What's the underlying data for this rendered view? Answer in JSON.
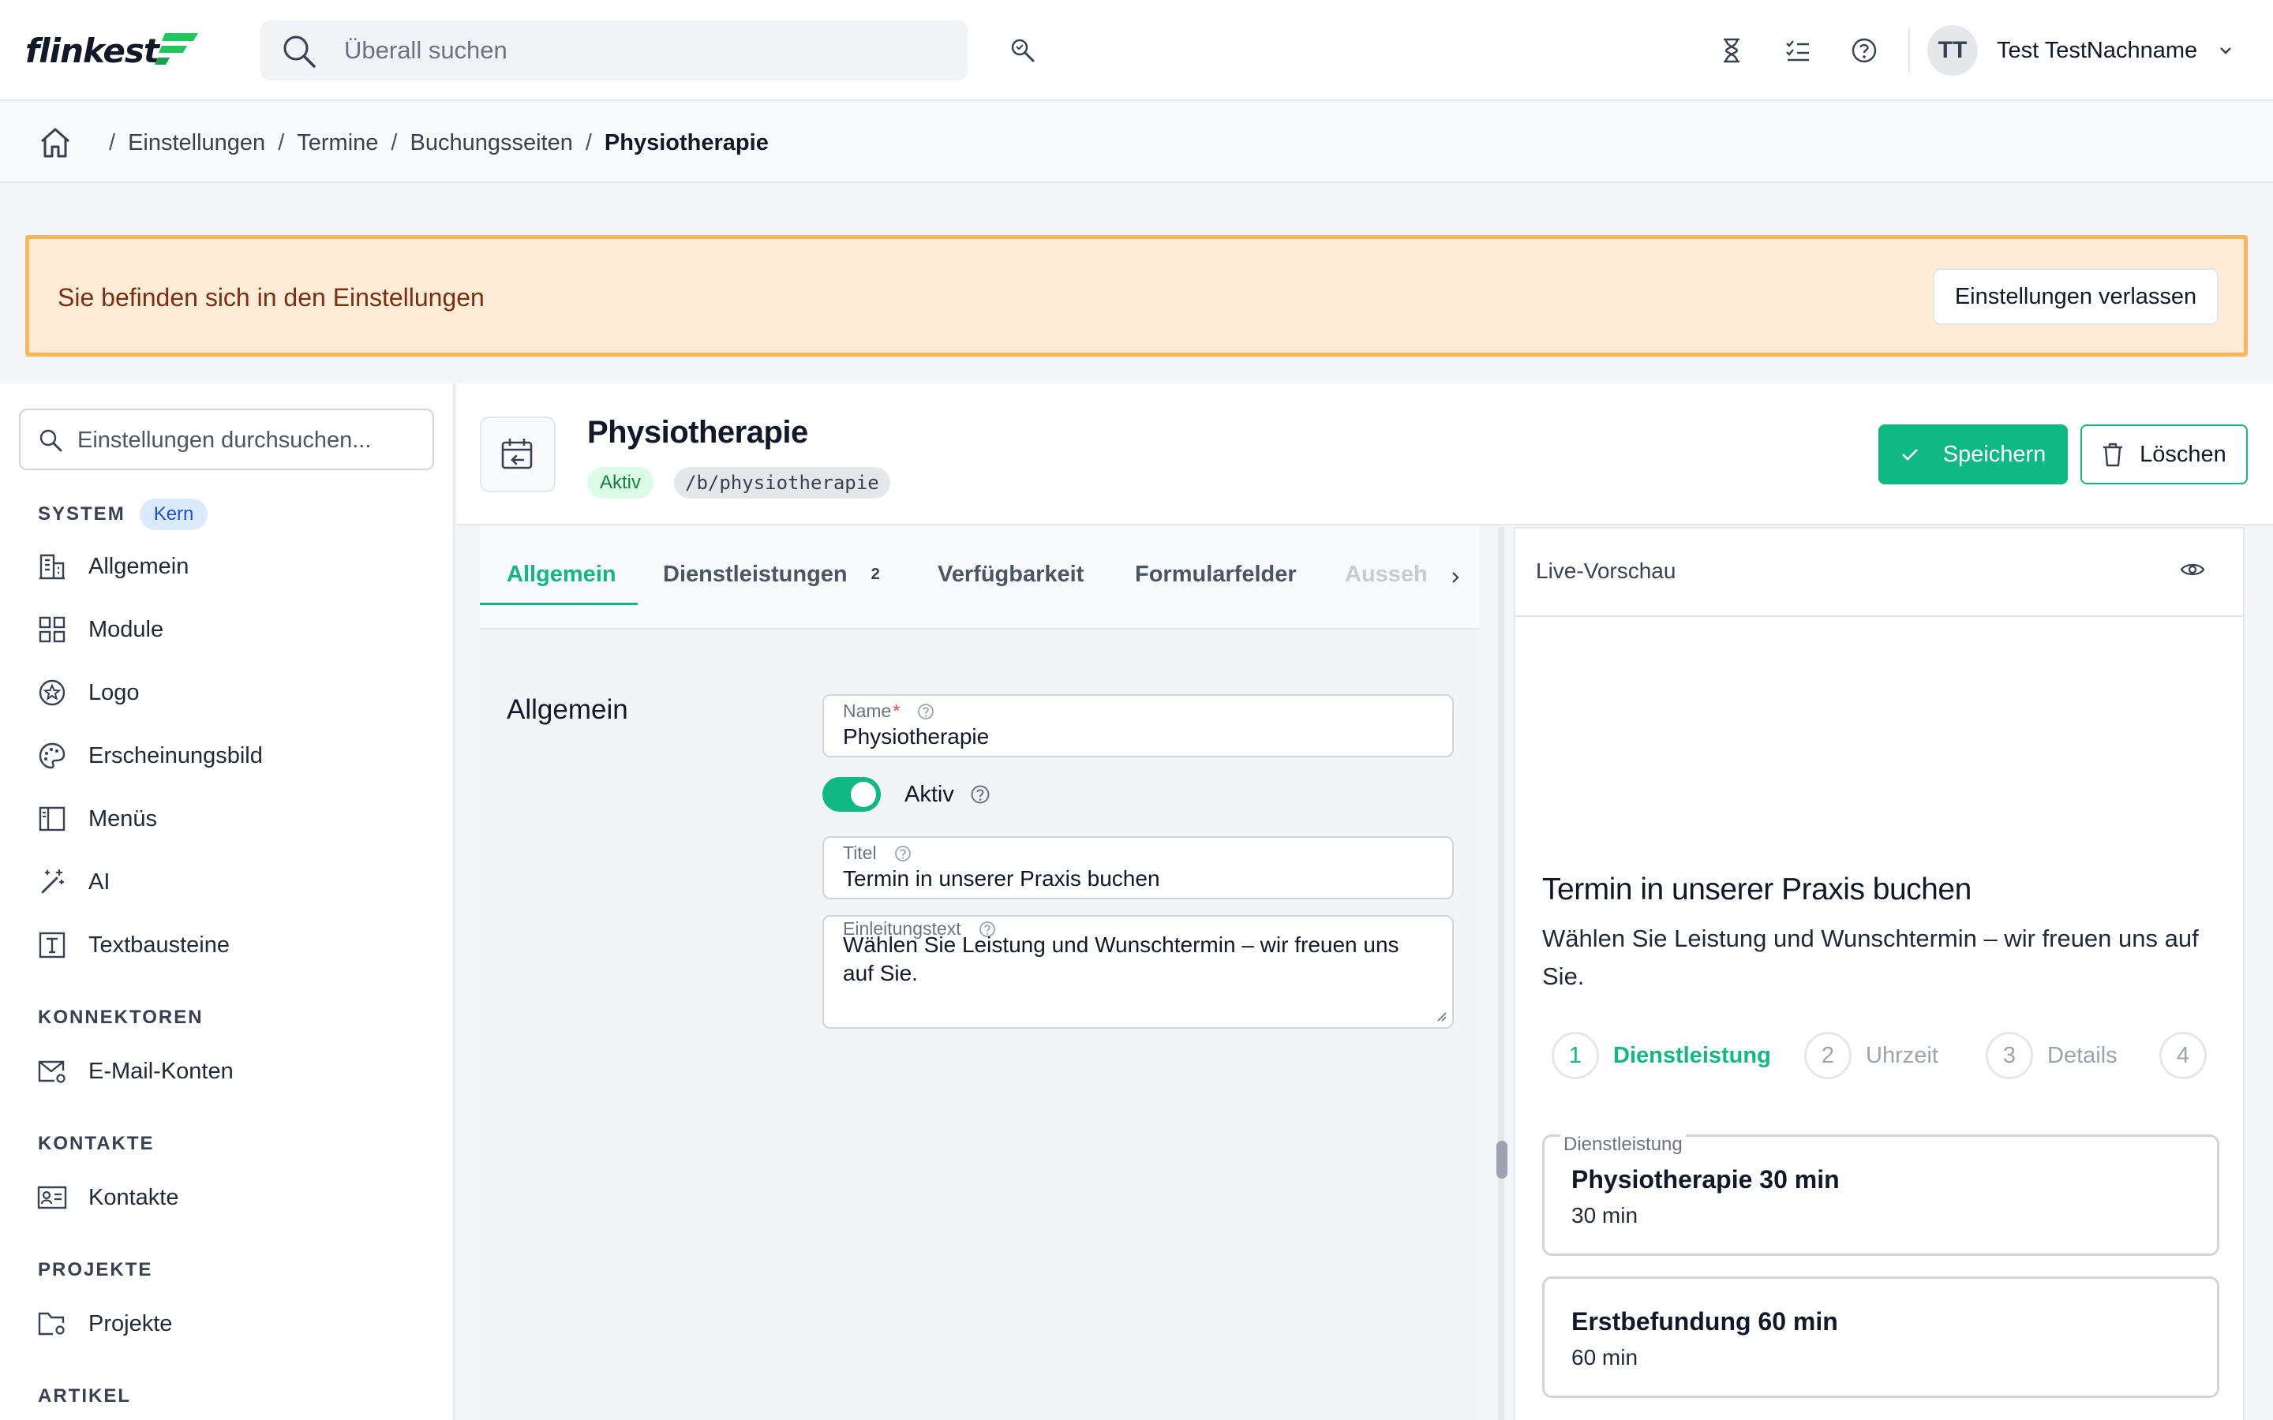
{
  "app": {
    "logo_text": "flinkest"
  },
  "topbar": {
    "search_placeholder": "Überall suchen",
    "user": {
      "initials": "TT",
      "name": "Test TestNachname"
    }
  },
  "breadcrumb": {
    "items": [
      "Einstellungen",
      "Termine",
      "Buchungsseiten"
    ],
    "current": "Physiotherapie",
    "separator": "/"
  },
  "banner": {
    "text": "Sie befinden sich in den Einstellungen",
    "button_label": "Einstellungen verlassen"
  },
  "sidebar": {
    "search_placeholder": "Einstellungen durchsuchen...",
    "sections": [
      {
        "title": "SYSTEM",
        "badge": "Kern",
        "items": [
          {
            "label": "Allgemein",
            "icon": "building-icon"
          },
          {
            "label": "Module",
            "icon": "grid-icon"
          },
          {
            "label": "Logo",
            "icon": "star-badge-icon"
          },
          {
            "label": "Erscheinungsbild",
            "icon": "palette-icon"
          },
          {
            "label": "Menüs",
            "icon": "sidebar-layout-icon"
          },
          {
            "label": "AI",
            "icon": "magic-wand-icon"
          },
          {
            "label": "Textbausteine",
            "icon": "text-box-icon"
          }
        ]
      },
      {
        "title": "KONNEKTOREN",
        "items": [
          {
            "label": "E-Mail-Konten",
            "icon": "mail-settings-icon"
          }
        ]
      },
      {
        "title": "KONTAKTE",
        "items": [
          {
            "label": "Kontakte",
            "icon": "contact-card-icon"
          }
        ]
      },
      {
        "title": "PROJEKTE",
        "items": [
          {
            "label": "Projekte",
            "icon": "folder-settings-icon"
          }
        ]
      },
      {
        "title": "ARTIKEL",
        "items": []
      }
    ]
  },
  "page": {
    "title": "Physiotherapie",
    "status_badge": "Aktiv",
    "slug": "/b/physiotherapie",
    "save_label": "Speichern",
    "delete_label": "Löschen"
  },
  "tabs": [
    {
      "label": "Allgemein",
      "active": true
    },
    {
      "label": "Dienstleistungen",
      "count": "2"
    },
    {
      "label": "Verfügbarkeit"
    },
    {
      "label": "Formularfelder"
    },
    {
      "label": "Ausseh"
    }
  ],
  "form": {
    "section_title": "Allgemein",
    "name": {
      "label": "Name",
      "required_mark": "*",
      "value": "Physiotherapie"
    },
    "active": {
      "label": "Aktiv",
      "checked": true
    },
    "title": {
      "label": "Titel",
      "value": "Termin in unserer Praxis buchen"
    },
    "intro": {
      "label": "Einleitungstext",
      "value": "Wählen Sie Leistung und Wunschtermin – wir freuen uns auf Sie."
    }
  },
  "preview": {
    "header": "Live-Vorschau",
    "heading": "Termin in unserer Praxis buchen",
    "intro": "Wählen Sie Leistung und Wunschtermin – wir freuen uns auf Sie.",
    "steps": [
      {
        "number": "1",
        "label": "Dienstleistung",
        "active": true
      },
      {
        "number": "2",
        "label": "Uhrzeit"
      },
      {
        "number": "3",
        "label": "Details"
      },
      {
        "number": "4",
        "label": ""
      }
    ],
    "service_legend": "Dienstleistung",
    "services": [
      {
        "name": "Physiotherapie 30 min",
        "duration": "30 min"
      },
      {
        "name": "Erstbefundung 60 min",
        "duration": "60 min"
      }
    ]
  },
  "colors": {
    "accent": "#10b981",
    "banner_bg": "#feedd6",
    "banner_border": "#fbb55a",
    "badge_blue_bg": "#dbeafe",
    "active_badge_bg": "#dcfce7"
  }
}
